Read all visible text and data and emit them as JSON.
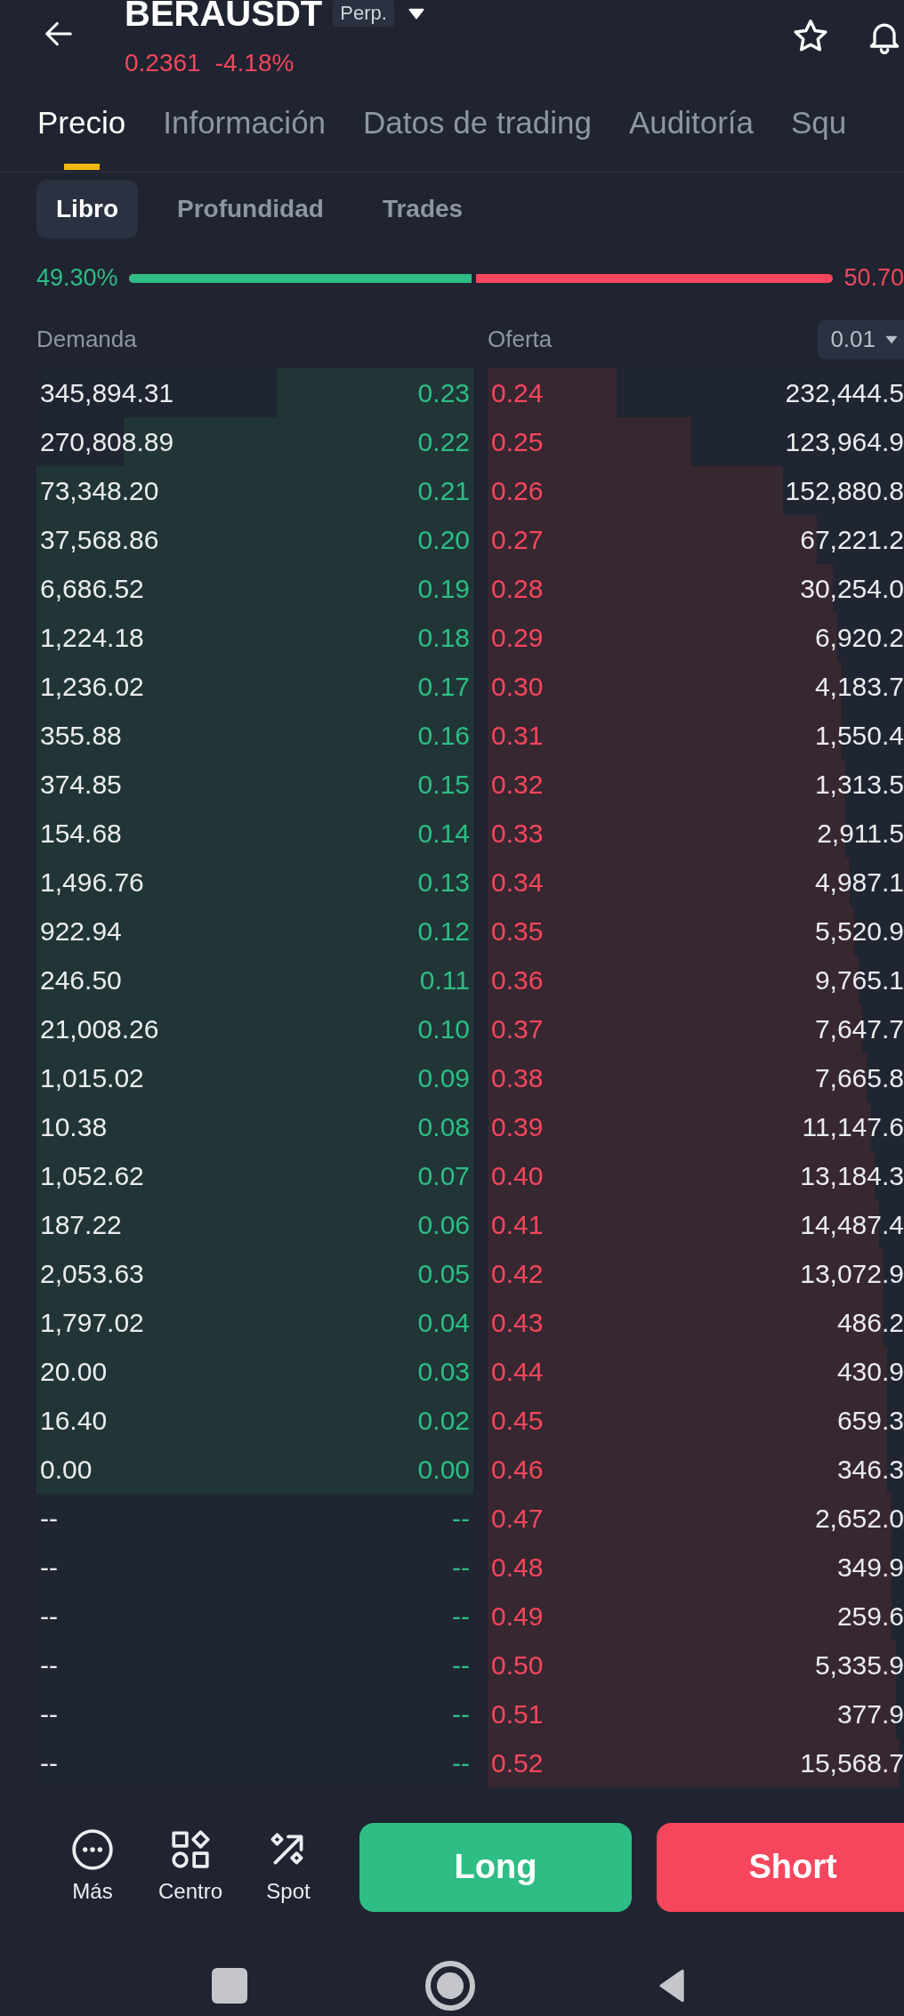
{
  "header": {
    "symbol": "BERAUSDT",
    "contract": "Perp.",
    "price": "0.2361",
    "change": "-4.18%"
  },
  "tabs": [
    {
      "label": "Precio",
      "selected": true
    },
    {
      "label": "Información",
      "selected": false
    },
    {
      "label": "Datos de trading",
      "selected": false
    },
    {
      "label": "Auditoría",
      "selected": false
    },
    {
      "label": "Squ",
      "selected": false
    }
  ],
  "subtabs": [
    {
      "label": "Libro",
      "selected": true
    },
    {
      "label": "Profundidad",
      "selected": false
    },
    {
      "label": "Trades",
      "selected": false
    }
  ],
  "ratio": {
    "bid_percent": "49.30%",
    "ask_percent": "50.70",
    "level": 0.493
  },
  "columns": {
    "bid": "Demanda",
    "ask": "Oferta",
    "precision": "0.01"
  },
  "rows": [
    {
      "bid": {
        "amount": "345,894.31",
        "price": "0.23",
        "level": 0.45
      },
      "ask": {
        "price": "0.24",
        "amount": "232,444.5",
        "level": 0.31
      }
    },
    {
      "bid": {
        "amount": "270,808.89",
        "price": "0.22",
        "level": 0.8
      },
      "ask": {
        "price": "0.25",
        "amount": "123,964.9",
        "level": 0.49
      }
    },
    {
      "bid": {
        "amount": "73,348.20",
        "price": "0.21",
        "level": 1
      },
      "ask": {
        "price": "0.26",
        "amount": "152,880.8",
        "level": 0.71
      }
    },
    {
      "bid": {
        "amount": "37,568.86",
        "price": "0.20",
        "level": 1
      },
      "ask": {
        "price": "0.27",
        "amount": "67,221.2",
        "level": 0.79
      }
    },
    {
      "bid": {
        "amount": "6,686.52",
        "price": "0.19",
        "level": 1
      },
      "ask": {
        "price": "0.28",
        "amount": "30,254.0",
        "level": 0.83
      }
    },
    {
      "bid": {
        "amount": "1,224.18",
        "price": "0.18",
        "level": 1
      },
      "ask": {
        "price": "0.29",
        "amount": "6,920.2",
        "level": 0.84
      }
    },
    {
      "bid": {
        "amount": "1,236.02",
        "price": "0.17",
        "level": 1
      },
      "ask": {
        "price": "0.30",
        "amount": "4,183.7",
        "level": 0.85
      }
    },
    {
      "bid": {
        "amount": "355.88",
        "price": "0.16",
        "level": 1
      },
      "ask": {
        "price": "0.31",
        "amount": "1,550.4",
        "level": 0.85
      }
    },
    {
      "bid": {
        "amount": "374.85",
        "price": "0.15",
        "level": 1
      },
      "ask": {
        "price": "0.32",
        "amount": "1,313.5",
        "level": 0.86
      }
    },
    {
      "bid": {
        "amount": "154.68",
        "price": "0.14",
        "level": 1
      },
      "ask": {
        "price": "0.33",
        "amount": "2,911.5",
        "level": 0.86
      }
    },
    {
      "bid": {
        "amount": "1,496.76",
        "price": "0.13",
        "level": 1
      },
      "ask": {
        "price": "0.34",
        "amount": "4,987.1",
        "level": 0.87
      }
    },
    {
      "bid": {
        "amount": "922.94",
        "price": "0.12",
        "level": 1
      },
      "ask": {
        "price": "0.35",
        "amount": "5,520.9",
        "level": 0.88
      }
    },
    {
      "bid": {
        "amount": "246.50",
        "price": "0.11",
        "level": 1
      },
      "ask": {
        "price": "0.36",
        "amount": "9,765.1",
        "level": 0.89
      }
    },
    {
      "bid": {
        "amount": "21,008.26",
        "price": "0.10",
        "level": 1
      },
      "ask": {
        "price": "0.37",
        "amount": "7,647.7",
        "level": 0.9
      }
    },
    {
      "bid": {
        "amount": "1,015.02",
        "price": "0.09",
        "level": 1
      },
      "ask": {
        "price": "0.38",
        "amount": "7,665.8",
        "level": 0.91
      }
    },
    {
      "bid": {
        "amount": "10.38",
        "price": "0.08",
        "level": 1
      },
      "ask": {
        "price": "0.39",
        "amount": "11,147.6",
        "level": 0.92
      }
    },
    {
      "bid": {
        "amount": "1,052.62",
        "price": "0.07",
        "level": 1
      },
      "ask": {
        "price": "0.40",
        "amount": "13,184.3",
        "level": 0.93
      }
    },
    {
      "bid": {
        "amount": "187.22",
        "price": "0.06",
        "level": 1
      },
      "ask": {
        "price": "0.41",
        "amount": "14,487.4",
        "level": 0.94
      }
    },
    {
      "bid": {
        "amount": "2,053.63",
        "price": "0.05",
        "level": 1
      },
      "ask": {
        "price": "0.42",
        "amount": "13,072.9",
        "level": 0.95
      }
    },
    {
      "bid": {
        "amount": "1,797.02",
        "price": "0.04",
        "level": 1
      },
      "ask": {
        "price": "0.43",
        "amount": "486.2",
        "level": 0.95
      }
    },
    {
      "bid": {
        "amount": "20.00",
        "price": "0.03",
        "level": 1
      },
      "ask": {
        "price": "0.44",
        "amount": "430.9",
        "level": 0.96
      }
    },
    {
      "bid": {
        "amount": "16.40",
        "price": "0.02",
        "level": 1
      },
      "ask": {
        "price": "0.45",
        "amount": "659.3",
        "level": 0.96
      }
    },
    {
      "bid": {
        "amount": "0.00",
        "price": "0.00",
        "level": 1
      },
      "ask": {
        "price": "0.46",
        "amount": "346.3",
        "level": 0.96
      }
    },
    {
      "bid": {
        "amount": "--",
        "price": "--",
        "level": 0
      },
      "ask": {
        "price": "0.47",
        "amount": "2,652.0",
        "level": 0.97
      }
    },
    {
      "bid": {
        "amount": "--",
        "price": "--",
        "level": 0
      },
      "ask": {
        "price": "0.48",
        "amount": "349.9",
        "level": 0.97
      }
    },
    {
      "bid": {
        "amount": "--",
        "price": "--",
        "level": 0
      },
      "ask": {
        "price": "0.49",
        "amount": "259.6",
        "level": 0.97
      }
    },
    {
      "bid": {
        "amount": "--",
        "price": "--",
        "level": 0
      },
      "ask": {
        "price": "0.50",
        "amount": "5,335.9",
        "level": 0.98
      }
    },
    {
      "bid": {
        "amount": "--",
        "price": "--",
        "level": 0
      },
      "ask": {
        "price": "0.51",
        "amount": "377.9",
        "level": 0.98
      }
    },
    {
      "bid": {
        "amount": "--",
        "price": "--",
        "level": 0
      },
      "ask": {
        "price": "0.52",
        "amount": "15,568.7",
        "level": 0.99
      }
    }
  ],
  "actions": [
    {
      "kind": "more",
      "label": "Más"
    },
    {
      "kind": "center",
      "label": "Centro"
    },
    {
      "kind": "spot",
      "label": "Spot"
    }
  ],
  "trade_buttons": [
    {
      "kind": "long",
      "label": "Long"
    },
    {
      "kind": "short",
      "label": "Short"
    }
  ]
}
